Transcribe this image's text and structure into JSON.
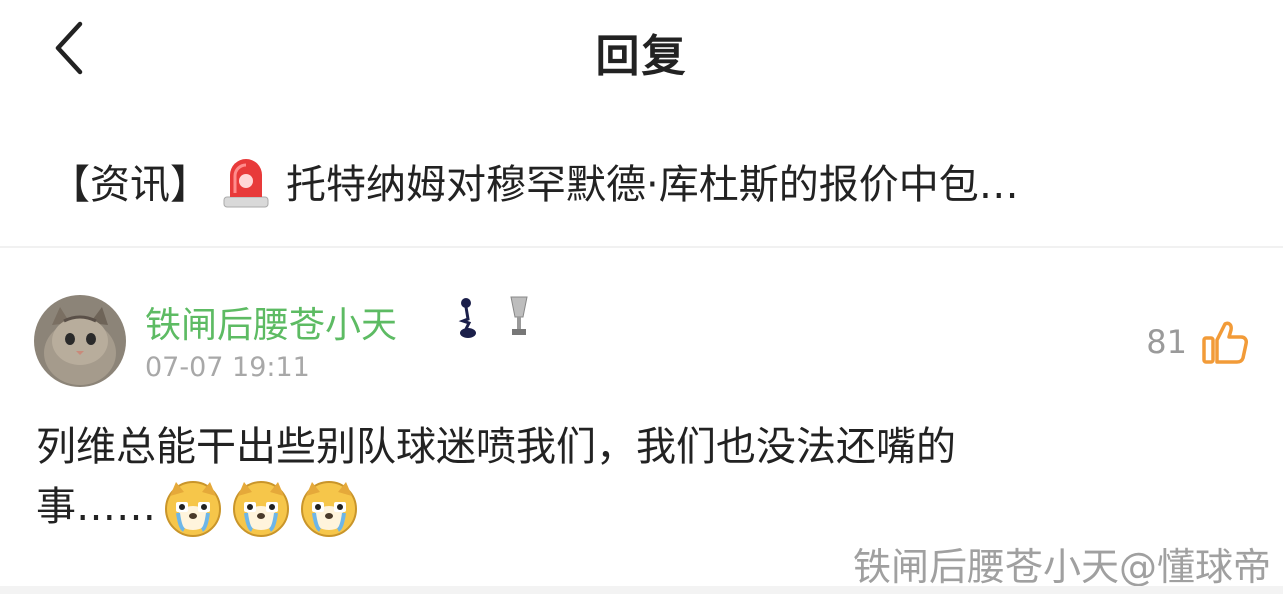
{
  "header": {
    "title": "回复"
  },
  "post": {
    "tag": "【资讯】",
    "title": "托特纳姆对穆罕默德·库杜斯的报价中包…"
  },
  "reply": {
    "username": "铁闸后腰苍小天",
    "timestamp": "07-07 19:11",
    "likes": "81",
    "text_line1": "列维总能干出些别队球迷喷我们，我们也没法还嘴的",
    "text_line2": "事……",
    "badges": [
      "tottenham-crest-icon",
      "trophy-icon"
    ],
    "emojis": [
      "crying-dog-emoji",
      "crying-dog-emoji",
      "crying-dog-emoji"
    ]
  },
  "watermark": "铁闸后腰苍小天@懂球帝",
  "colors": {
    "username": "#5dbb63",
    "like_icon": "#f29b38",
    "muted": "#a8a8a8"
  }
}
